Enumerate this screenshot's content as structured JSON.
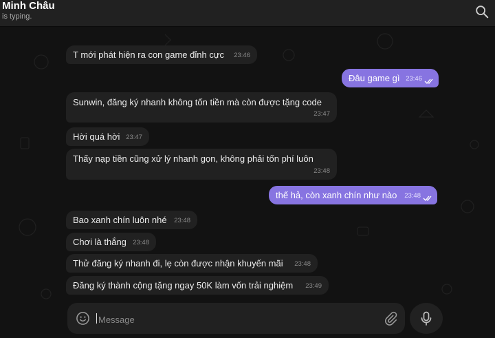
{
  "header": {
    "name": "Minh Châu",
    "status": "is typing."
  },
  "icons": {
    "search": "search-icon",
    "emoji": "emoji-icon",
    "attach": "paperclip-icon",
    "mic": "microphone-icon",
    "read": "double-check-icon"
  },
  "colors": {
    "incoming_bubble": "#212121",
    "outgoing_bubble": "#8774e1",
    "background": "#121212"
  },
  "messages": [
    {
      "dir": "in",
      "text": "T mới phát hiện ra con game đỉnh cực",
      "time": "23:46"
    },
    {
      "dir": "out",
      "text": "Đâu game gì",
      "time": "23:46",
      "read": true
    },
    {
      "dir": "in",
      "text": "Sunwin, đăng ký nhanh không tốn tiền mà còn được tặng code",
      "time": "23:47"
    },
    {
      "dir": "in",
      "text": "Hời quá hời",
      "time": "23:47"
    },
    {
      "dir": "in",
      "text": "Thấy nạp tiền cũng xử lý nhanh gọn, không phải tốn phí luôn",
      "time": "23:48"
    },
    {
      "dir": "out",
      "text": "thế hả, còn xanh chín như nào",
      "time": "23:48",
      "read": true
    },
    {
      "dir": "in",
      "text": "Bao xanh chín luôn nhé",
      "time": "23:48"
    },
    {
      "dir": "in",
      "text": "Chơi là thắng",
      "time": "23:48"
    },
    {
      "dir": "in",
      "text": "Thử đăng ký nhanh đi, lẹ còn được nhận khuyến mãi",
      "time": "23:48"
    },
    {
      "dir": "in",
      "text": "Đăng ký thành cộng tặng ngay 50K làm vốn trải nghiệm",
      "time": "23:49"
    }
  ],
  "composer": {
    "placeholder": "Message"
  }
}
